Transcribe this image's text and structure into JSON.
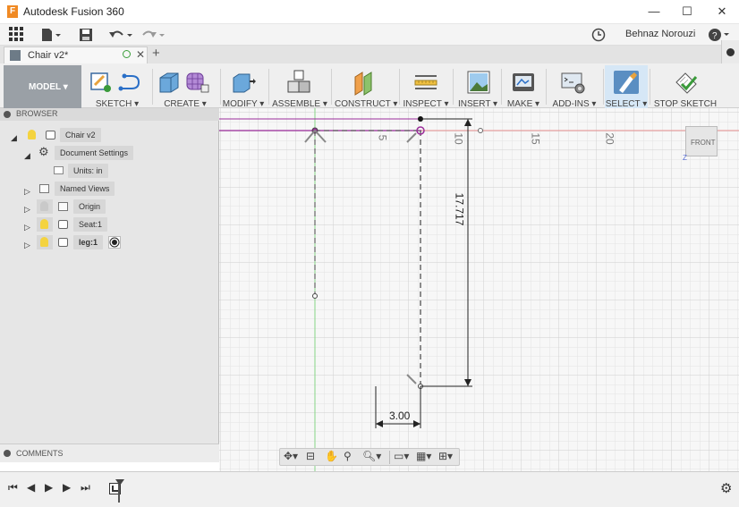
{
  "app": {
    "title": "Autodesk Fusion 360"
  },
  "window_controls": {
    "minimize": "—",
    "maximize": "☐",
    "close": "✕"
  },
  "quick_access": {
    "user": "Behnaz Norouzi"
  },
  "doc_tab": {
    "title": "Chair v2*"
  },
  "toolbar": {
    "workspace": "MODEL ▾",
    "groups": [
      "SKETCH ▾",
      "CREATE ▾",
      "MODIFY ▾",
      "ASSEMBLE ▾",
      "CONSTRUCT ▾",
      "INSPECT ▾",
      "INSERT ▾",
      "MAKE ▾",
      "ADD-INS ▾",
      "SELECT ▾",
      "STOP SKETCH"
    ]
  },
  "browser": {
    "header": "BROWSER",
    "nodes": {
      "root": "Chair v2",
      "doc_settings": "Document Settings",
      "units": "Units: in",
      "named_views": "Named Views",
      "origin": "Origin",
      "seat": "Seat:1",
      "leg": "leg:1"
    }
  },
  "comments": {
    "header": "COMMENTS"
  },
  "canvas": {
    "ruler_labels": [
      "5",
      "10",
      "15",
      "20"
    ],
    "dimension_vertical": "17.717",
    "dimension_horizontal": "3.00",
    "viewcube_label": "FRONT",
    "viewcube_axis": "Z"
  },
  "colors": {
    "accent": "#0696d7",
    "sketch_line": "#3d3d3d",
    "red_axis": "#e07070",
    "green_axis": "#77cc77",
    "purple": "#9b2d9b"
  }
}
